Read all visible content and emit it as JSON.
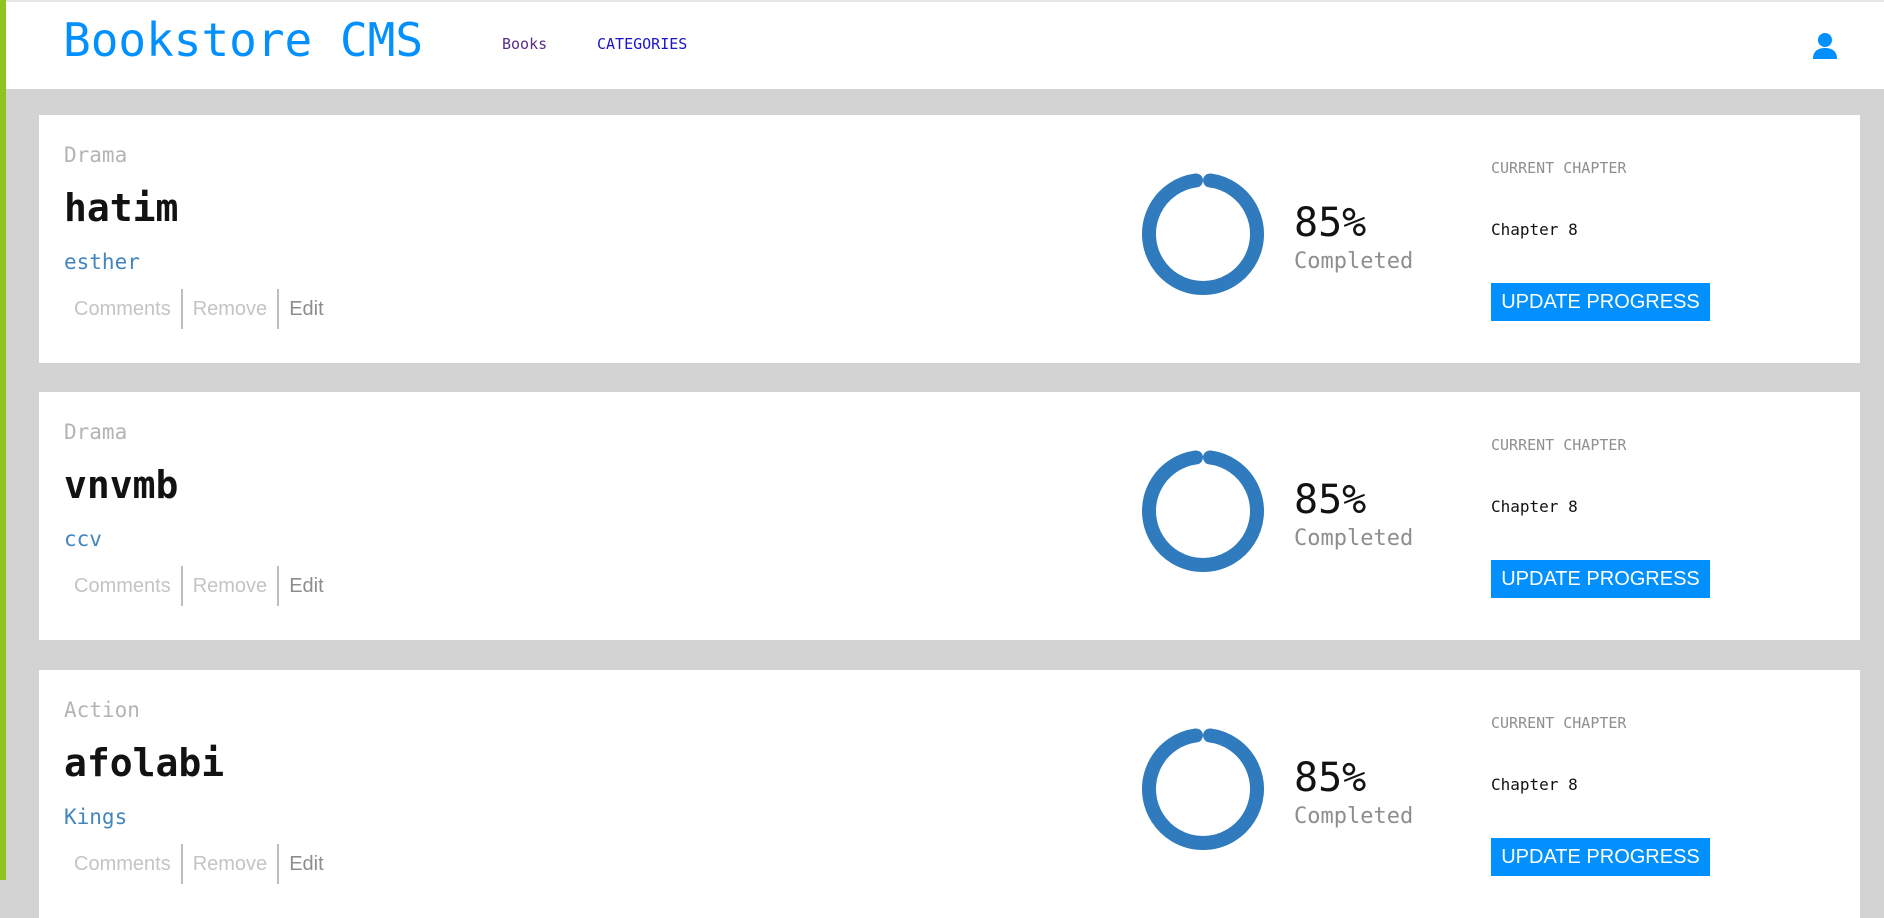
{
  "header": {
    "brand": "Bookstore CMS",
    "nav": {
      "books": "Books",
      "categories": "CATEGORIES"
    },
    "user_icon": "user-icon"
  },
  "books": [
    {
      "category": "Drama",
      "title": "hatim",
      "author": "esther",
      "actions": {
        "comments": "Comments",
        "remove": "Remove",
        "edit": "Edit"
      },
      "progress": {
        "percent": "85%",
        "status": "Completed",
        "value": 0.85
      },
      "chapter": {
        "label": "CURRENT CHAPTER",
        "value": "Chapter 8"
      },
      "update_label": "UPDATE PROGRESS"
    },
    {
      "category": "Drama",
      "title": "vnvmb",
      "author": "ccv",
      "actions": {
        "comments": "Comments",
        "remove": "Remove",
        "edit": "Edit"
      },
      "progress": {
        "percent": "85%",
        "status": "Completed",
        "value": 0.85
      },
      "chapter": {
        "label": "CURRENT CHAPTER",
        "value": "Chapter 8"
      },
      "update_label": "UPDATE PROGRESS"
    },
    {
      "category": "Action",
      "title": "afolabi",
      "author": "Kings",
      "actions": {
        "comments": "Comments",
        "remove": "Remove",
        "edit": "Edit"
      },
      "progress": {
        "percent": "85%",
        "status": "Completed",
        "value": 0.85
      },
      "chapter": {
        "label": "CURRENT CHAPTER",
        "value": "Chapter 8"
      },
      "update_label": "UPDATE PROGRESS"
    }
  ],
  "colors": {
    "accent": "#0290ff",
    "progress": "#307bbe",
    "sidebar_strip": "#8fc31f",
    "background": "#d3d3d3"
  }
}
